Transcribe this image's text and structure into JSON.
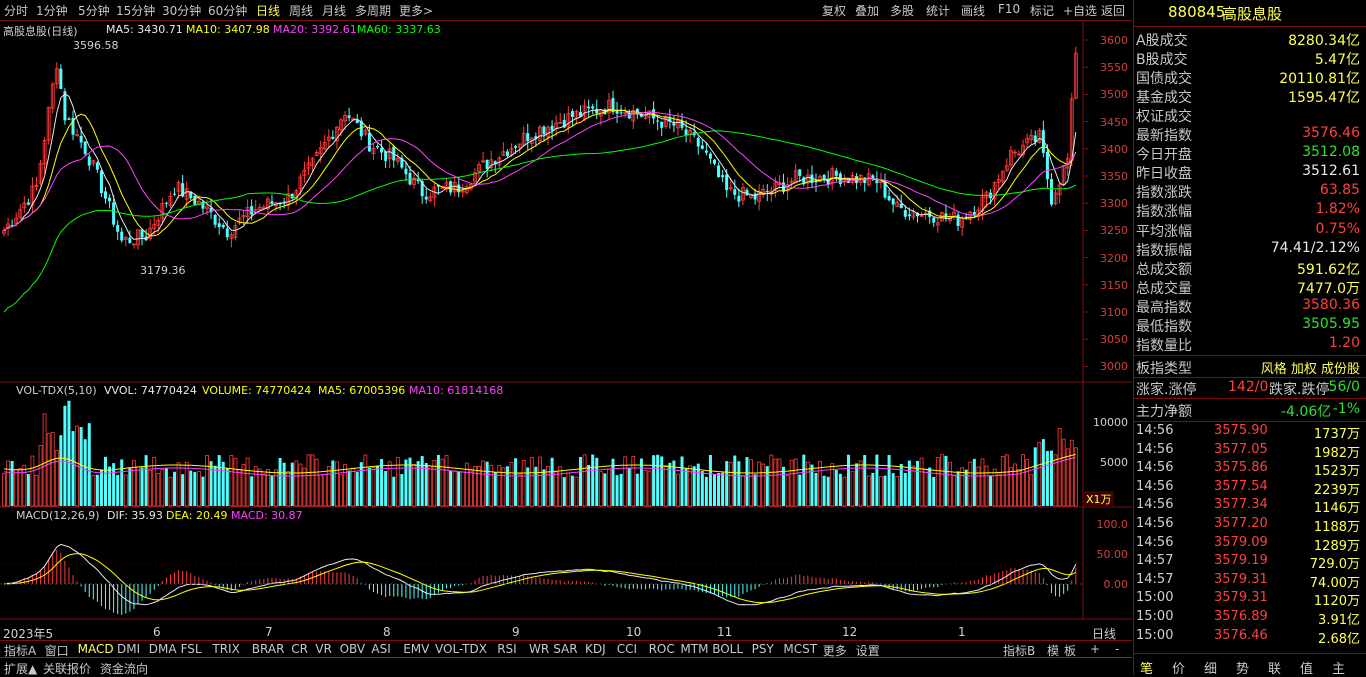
{
  "top_tabs": [
    "分时",
    "1分钟",
    "5分钟",
    "15分钟",
    "30分钟",
    "60分钟",
    "日线",
    "周线",
    "月线",
    "多周期",
    "更多>"
  ],
  "selected_tab": "日线",
  "top_right": [
    "复权",
    "叠加",
    "多股",
    "统计",
    "画线",
    "F10",
    "标记",
    "+自选",
    "返回"
  ],
  "main_legend": {
    "name": "高股息股(日线)",
    "ma5": "MA5: 3430.71",
    "ma10": "MA10: 3407.98",
    "ma20": "MA20: 3392.61",
    "ma60": "MA60: 3337.63"
  },
  "price_axis": [
    "3600",
    "3550",
    "3500",
    "3450",
    "3400",
    "3350",
    "3300",
    "3250",
    "3200",
    "3150",
    "3100",
    "3050",
    "3000"
  ],
  "annotations": {
    "high": "3596.58",
    "low": "3179.36"
  },
  "vol_legend": {
    "name": "VOL-TDX(5,10)",
    "vvol": "VVOL: 74770424",
    "volume": "VOLUME: 74770424",
    "ma5": "MA5: 67005396",
    "ma10": "MA10: 61814168"
  },
  "vol_axis": [
    "10000",
    "5000"
  ],
  "vol_unit": "X1万",
  "macd_legend": {
    "name": "MACD(12,26,9)",
    "dif": "DIF: 35.93",
    "dea": "DEA: 20.49",
    "macd": "MACD: 30.87"
  },
  "macd_axis": [
    "100.0",
    "50.00",
    "0.00"
  ],
  "date_axis": [
    "2023年5",
    "6",
    "7",
    "8",
    "9",
    "10",
    "11",
    "12",
    "1"
  ],
  "date_axis_end": "日线",
  "indicator_tabs": [
    "指标A",
    "窗口",
    "MACD",
    "DMI",
    "DMA",
    "FSL",
    "TRIX",
    "BRAR",
    "CR",
    "VR",
    "OBV",
    "ASI",
    "EMV",
    "VOL-TDX",
    "RSI",
    "WR",
    "SAR",
    "KDJ",
    "CCI",
    "ROC",
    "MTM",
    "BOLL",
    "PSY",
    "MCST",
    "更多",
    "设置"
  ],
  "indicator_right": [
    "指标B",
    "模",
    "板",
    "+",
    "-"
  ],
  "bottom_tabs": [
    "扩展▲",
    "关联报价",
    "资金流向"
  ],
  "panel": {
    "code": "880845",
    "name": "高股息股",
    "rows": [
      {
        "label": "A股成交",
        "value": "8280.34亿",
        "color": "yel"
      },
      {
        "label": "B股成交",
        "value": "5.47亿",
        "color": "yel"
      },
      {
        "label": "国债成交",
        "value": "20110.81亿",
        "color": "yel"
      },
      {
        "label": "基金成交",
        "value": "1595.47亿",
        "color": "yel"
      },
      {
        "label": "权证成交",
        "value": "",
        "color": "yel"
      },
      {
        "label": "最新指数",
        "value": "3576.46",
        "color": "red"
      },
      {
        "label": "今日开盘",
        "value": "3512.08",
        "color": "grn"
      },
      {
        "label": "昨日收盘",
        "value": "3512.61",
        "color": "wht"
      },
      {
        "label": "指数涨跌",
        "value": "63.85",
        "color": "red"
      },
      {
        "label": "指数涨幅",
        "value": "1.82%",
        "color": "red"
      },
      {
        "label": "平均涨幅",
        "value": "0.75%",
        "color": "red"
      },
      {
        "label": "指数振幅",
        "value": "74.41/2.12%",
        "color": "wht"
      },
      {
        "label": "总成交额",
        "value": "591.62亿",
        "color": "yel"
      },
      {
        "label": "总成交量",
        "value": "7477.0万",
        "color": "yel"
      },
      {
        "label": "最高指数",
        "value": "3580.36",
        "color": "red"
      },
      {
        "label": "最低指数",
        "value": "3505.95",
        "color": "grn"
      },
      {
        "label": "指数量比",
        "value": "1.20",
        "color": "red"
      }
    ],
    "type_label": "板指类型",
    "type_value": "风格 加权 成份股",
    "updown_label": "涨家.涨停",
    "updown_value": "142/0",
    "down_label": "跌家.跌停",
    "down_value": "56/0",
    "main_label": "主力净额",
    "main_value": "-4.06亿",
    "main_pct": "-1%",
    "ticks": [
      {
        "time": "14:56",
        "price": "3575.90",
        "vol": "1737万"
      },
      {
        "time": "14:56",
        "price": "3577.05",
        "vol": "1982万"
      },
      {
        "time": "14:56",
        "price": "3575.86",
        "vol": "1523万"
      },
      {
        "time": "14:56",
        "price": "3577.54",
        "vol": "2239万"
      },
      {
        "time": "14:56",
        "price": "3577.34",
        "vol": "1146万"
      },
      {
        "time": "14:56",
        "price": "3577.20",
        "vol": "1188万"
      },
      {
        "time": "14:56",
        "price": "3579.09",
        "vol": "1289万"
      },
      {
        "time": "14:57",
        "price": "3579.19",
        "vol": "729.0万"
      },
      {
        "time": "14:57",
        "price": "3579.31",
        "vol": "74.00万"
      },
      {
        "time": "15:00",
        "price": "3579.31",
        "vol": "1120万"
      },
      {
        "time": "15:00",
        "price": "3576.89",
        "vol": "3.91亿"
      },
      {
        "time": "15:00",
        "price": "3576.46",
        "vol": "2.68亿"
      }
    ],
    "bottom_tabs": [
      "笔",
      "价",
      "细",
      "势",
      "联",
      "值",
      "主"
    ]
  },
  "colors": {
    "up": "#ff3c3c",
    "down": "#50ffff",
    "ma5": "#e8e8e8",
    "ma10": "#ffff00",
    "ma20": "#ff40ff",
    "ma60": "#00ff00",
    "frame": "#7a1010"
  }
}
